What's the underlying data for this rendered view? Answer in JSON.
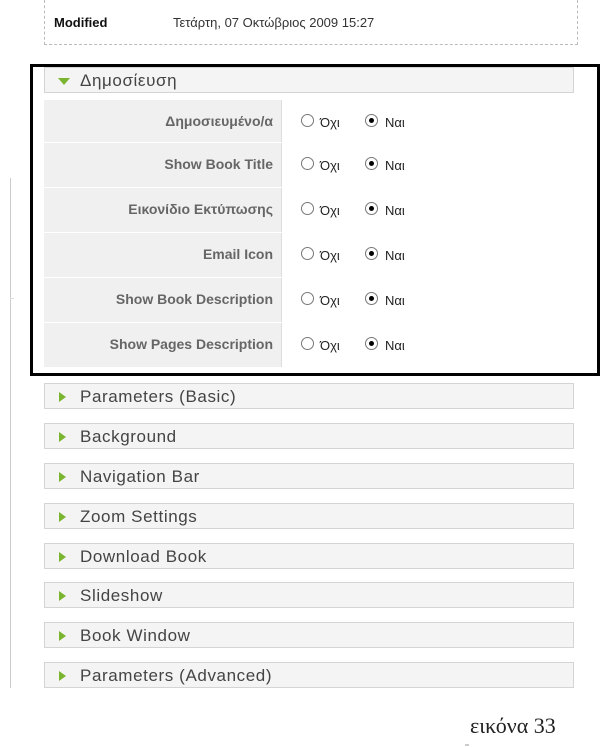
{
  "modified": {
    "label": "Modified",
    "value": "Τετάρτη, 07 Οκτώβριος 2009 15:27"
  },
  "publish_section": {
    "title": "Δημοσίευση",
    "option_no": "Όχι",
    "option_yes": "Ναι",
    "rows": [
      {
        "label": "Δημοσιευμένο/α",
        "selected": "yes"
      },
      {
        "label": "Show Book Title",
        "selected": "yes"
      },
      {
        "label": "Εικονίδιο Εκτύπωσης",
        "selected": "yes"
      },
      {
        "label": "Email Icon",
        "selected": "yes"
      },
      {
        "label": "Show Book Description",
        "selected": "yes"
      },
      {
        "label": "Show Pages Description",
        "selected": "yes"
      }
    ]
  },
  "collapsed_panels": [
    "Parameters (Basic)",
    "Background",
    "Navigation Bar",
    "Zoom Settings",
    "Download Book",
    "Slideshow",
    "Book Window",
    "Parameters (Advanced)"
  ],
  "caption": "εικόνα 33"
}
